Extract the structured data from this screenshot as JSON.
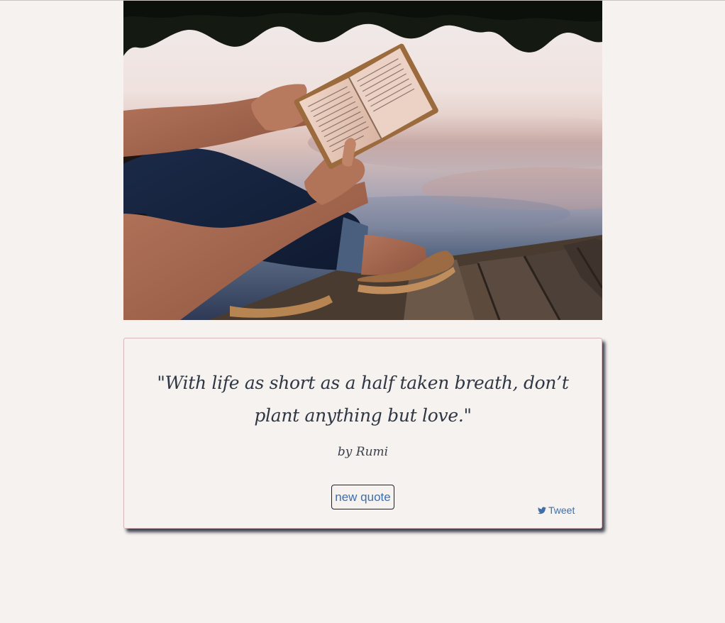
{
  "hero": {
    "image_description_icon": "reading-book-photo"
  },
  "quote": {
    "text": "\"With life as short as a half taken breath, don’t plant anything but love.\"",
    "author": "by Rumi"
  },
  "actions": {
    "new_quote_label": "new quote",
    "tweet_label": "Tweet",
    "tweet_icon": "twitter-bird-icon"
  },
  "colors": {
    "background": "#f5f2ef",
    "quote_text": "#2f3644",
    "link_blue": "#3a6fb0",
    "card_border": "#d7b9bd"
  }
}
